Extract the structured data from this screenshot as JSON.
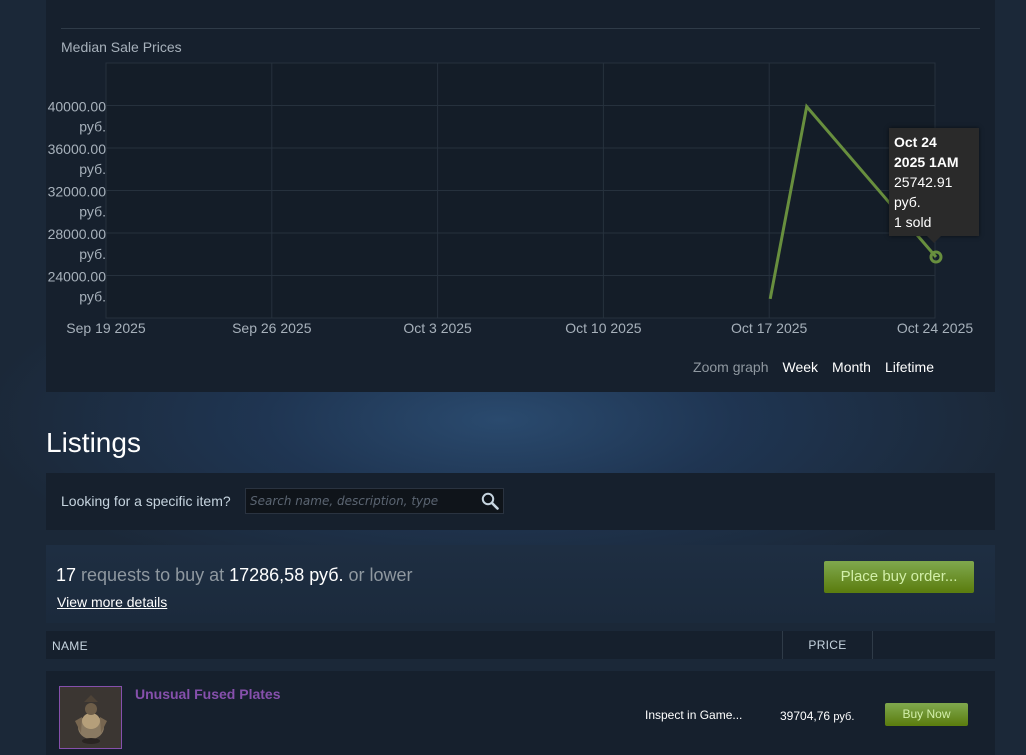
{
  "chart": {
    "title": "Median Sale Prices",
    "zoom_label": "Zoom graph",
    "zoom_options": [
      "Week",
      "Month",
      "Lifetime"
    ],
    "tooltip": {
      "date_line1": "Oct 24",
      "date_line2": "2025 1AM",
      "price": "25742.91",
      "currency": "руб.",
      "sold": "1 sold"
    }
  },
  "chart_data": {
    "type": "line",
    "title": "Median Sale Prices",
    "x_tick_labels": [
      "Sep 19 2025",
      "Sep 26 2025",
      "Oct 3 2025",
      "Oct 10 2025",
      "Oct 17 2025",
      "Oct 24 2025"
    ],
    "y_tick_labels": [
      "40000.00 руб.",
      "36000.00 руб.",
      "32000.00 руб.",
      "28000.00 руб.",
      "24000.00 руб."
    ],
    "y_ticks": [
      40000,
      36000,
      32000,
      28000,
      24000
    ],
    "xlim": [
      "2025-09-19",
      "2025-10-24"
    ],
    "ylim": [
      20000,
      44000
    ],
    "grid": true,
    "series": [
      {
        "color": "#688f3e",
        "points": [
          {
            "x": "2025-10-17T01:00",
            "y": 21800
          },
          {
            "x": "2025-10-18T14:00",
            "y": 39900
          },
          {
            "x": "2025-10-24T01:00",
            "y": 25742.91
          }
        ]
      }
    ]
  },
  "listings": {
    "heading": "Listings",
    "search_label": "Looking for a specific item?",
    "search_placeholder": "Search name, description, type",
    "orders": {
      "count": "17",
      "text1": " requests to buy at ",
      "price": "17286,58 руб.",
      "text2": " or lower",
      "details_link": "View more details",
      "place_button": "Place buy order..."
    },
    "columns": {
      "name": "NAME",
      "price": "PRICE"
    },
    "items": [
      {
        "name": "Unusual Fused Plates",
        "inspect": "Inspect in Game...",
        "price": "39704,76",
        "currency": "руб.",
        "buy": "Buy Now"
      }
    ]
  }
}
